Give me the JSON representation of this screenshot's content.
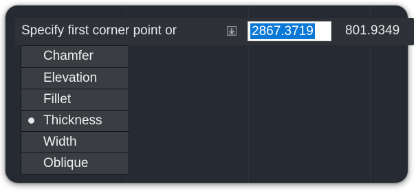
{
  "prompt": {
    "text": "Specify first corner point or",
    "icon": "down-arrow-icon",
    "x_value": "2867.3719",
    "y_value": "801.9349"
  },
  "menu": {
    "items": [
      {
        "label": "Chamfer",
        "selected": false
      },
      {
        "label": "Elevation",
        "selected": false
      },
      {
        "label": "Fillet",
        "selected": false
      },
      {
        "label": "Thickness",
        "selected": true
      },
      {
        "label": "Width",
        "selected": false
      },
      {
        "label": "Oblique",
        "selected": false
      }
    ]
  },
  "colors": {
    "canvas": "#262b33",
    "selection": "#0a78d7",
    "menu_bg": "#3a3d42"
  }
}
